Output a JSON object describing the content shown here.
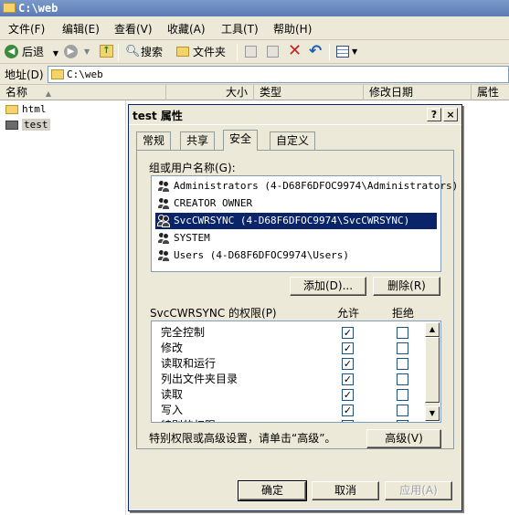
{
  "window": {
    "title": "C:\\web"
  },
  "menu": [
    "文件(F)",
    "编辑(E)",
    "查看(V)",
    "收藏(A)",
    "工具(T)",
    "帮助(H)"
  ],
  "toolbar": {
    "back": "后退",
    "search": "搜索",
    "folders": "文件夹"
  },
  "address": {
    "label": "地址(D)",
    "value": "C:\\web"
  },
  "columns": [
    "名称",
    "大小",
    "类型",
    "修改日期",
    "属性"
  ],
  "tree": [
    {
      "label": "html",
      "selected": false
    },
    {
      "label": "test",
      "selected": true
    }
  ],
  "dialog": {
    "title": "test 属性",
    "help_btn": "?",
    "close_btn": "×",
    "tabs": [
      "常规",
      "共享",
      "安全",
      "自定义"
    ],
    "active_tab": "安全",
    "group_label": "组或用户名称(G):",
    "users": [
      "Administrators (4-D68F6DFOC9974\\Administrators)",
      "CREATOR OWNER",
      "SvcCWRSYNC (4-D68F6DFOC9974\\SvcCWRSYNC)",
      "SYSTEM",
      "Users (4-D68F6DFOC9974\\Users)"
    ],
    "selected_user_index": 2,
    "add_btn": "添加(D)...",
    "remove_btn": "删除(R)",
    "perm_label": "SvcCWRSYNC 的权限(P)",
    "allow_header": "允许",
    "deny_header": "拒绝",
    "permissions": [
      {
        "name": "完全控制",
        "allow": true,
        "deny": false
      },
      {
        "name": "修改",
        "allow": true,
        "deny": false
      },
      {
        "name": "读取和运行",
        "allow": true,
        "deny": false
      },
      {
        "name": "列出文件夹目录",
        "allow": true,
        "deny": false
      },
      {
        "name": "读取",
        "allow": true,
        "deny": false
      },
      {
        "name": "写入",
        "allow": true,
        "deny": false
      },
      {
        "name": "特别的权限",
        "allow": true,
        "deny": false
      }
    ],
    "advanced_text": "特别权限或高级设置，请单击“高级”。",
    "advanced_btn": "高级(V)",
    "ok_btn": "确定",
    "cancel_btn": "取消",
    "apply_btn": "应用(A)",
    "check_mark": "✓"
  }
}
